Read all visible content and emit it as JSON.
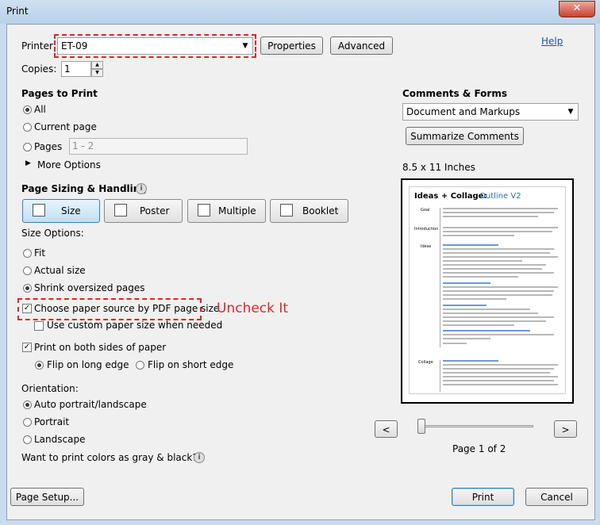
{
  "window": {
    "title": "Print",
    "close_glyph": "✕"
  },
  "help_link": "Help",
  "printer": {
    "label": "Printer:",
    "value": "ET-09",
    "properties": "Properties",
    "advanced": "Advanced"
  },
  "copies": {
    "label": "Copies:",
    "value": "1"
  },
  "pages_to_print": {
    "heading": "Pages to Print",
    "all": "All",
    "current": "Current page",
    "pages": "Pages",
    "pages_placeholder": "1 - 2",
    "more_options": "More Options"
  },
  "sizing": {
    "heading": "Page Sizing & Handling",
    "buttons": {
      "size": "Size",
      "poster": "Poster",
      "multiple": "Multiple",
      "booklet": "Booklet"
    },
    "size_options_label": "Size Options:",
    "fit": "Fit",
    "actual": "Actual size",
    "shrink": "Shrink oversized pages",
    "choose_source": "Choose paper source by PDF page size",
    "custom_paper": "Use custom paper size when needed",
    "both_sides": "Print on both sides of paper",
    "flip_long": "Flip on long edge",
    "flip_short": "Flip on short edge"
  },
  "annotation": {
    "text": "Uncheck It",
    "color": "#e0242a"
  },
  "orientation": {
    "label": "Orientation:",
    "auto": "Auto portrait/landscape",
    "portrait": "Portrait",
    "landscape": "Landscape"
  },
  "gray_question": "Want to print colors as gray & black?",
  "comments_forms": {
    "heading": "Comments & Forms",
    "value": "Document and Markups",
    "summarize": "Summarize Comments"
  },
  "preview": {
    "paper_size": "8.5 x 11 Inches",
    "doc_title_a": "Ideas + Collage:",
    "doc_title_b": "Outline V2",
    "sections": [
      "Goal",
      "Introduction",
      "Ideas",
      "Collage"
    ],
    "page_status": "Page 1 of 2",
    "slider_position": 0
  },
  "footer": {
    "page_setup": "Page Setup...",
    "print": "Print",
    "cancel": "Cancel"
  },
  "icons": {
    "size": "fit-page-icon",
    "poster": "poster-icon",
    "multiple": "multiple-pages-icon",
    "booklet": "booklet-icon",
    "info": "info-icon"
  }
}
